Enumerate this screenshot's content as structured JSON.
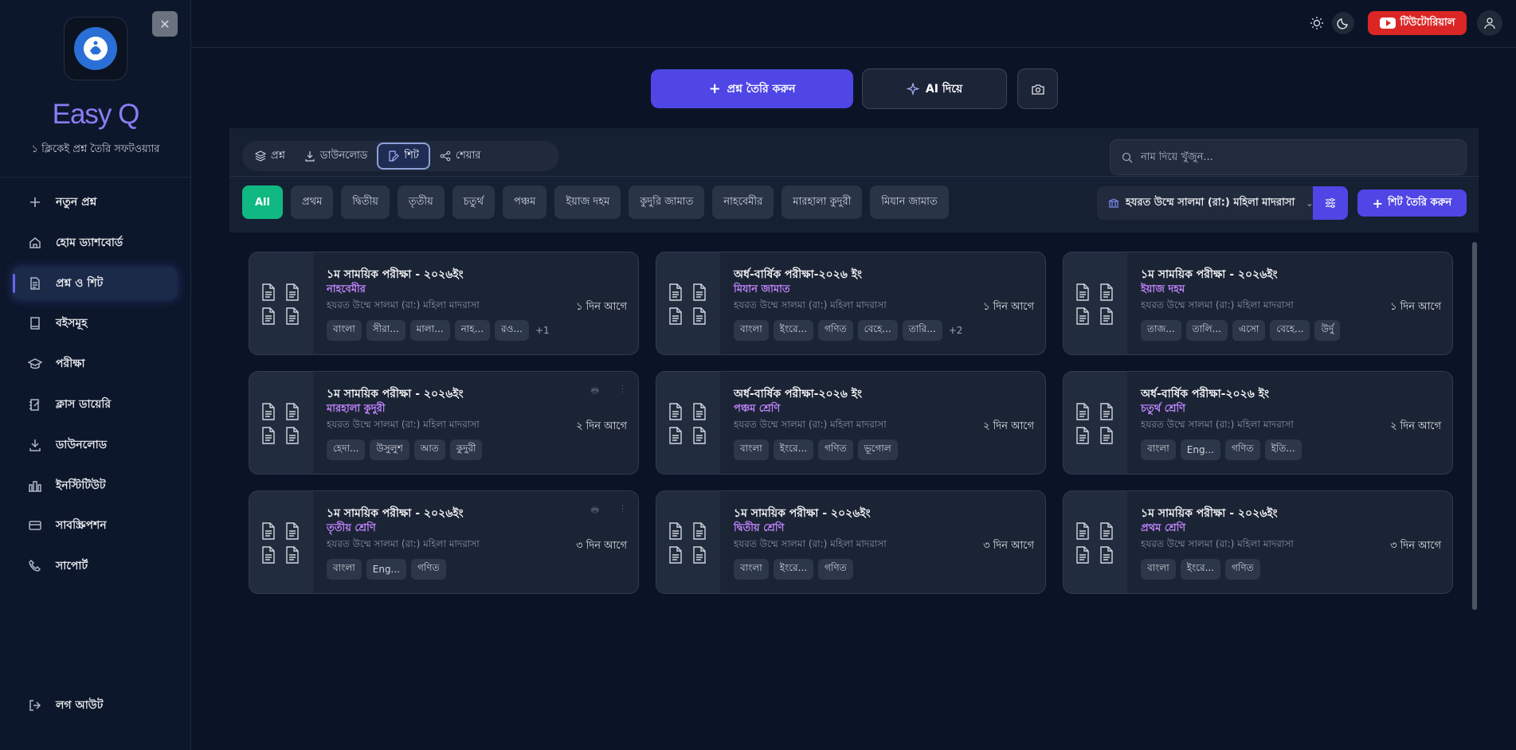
{
  "app": {
    "name": "Easy Q",
    "tagline": "১ ক্লিকেই প্রশ্ন তৈরি সফটওয়্যার"
  },
  "sidebar": {
    "items": [
      {
        "label": "নতুন প্রশ্ন",
        "icon": "plus-icon"
      },
      {
        "label": "হোম ড্যাশবোর্ড",
        "icon": "home-icon"
      },
      {
        "label": "প্রশ্ন ও শিট",
        "icon": "document-icon",
        "active": true
      },
      {
        "label": "বইসমূহ",
        "icon": "book-icon"
      },
      {
        "label": "পরীক্ষা",
        "icon": "graduation-cap-icon"
      },
      {
        "label": "ক্লাস ডায়েরি",
        "icon": "diary-icon"
      },
      {
        "label": "ডাউনলোড",
        "icon": "download-icon"
      },
      {
        "label": "ইনস্টিটিউট",
        "icon": "institute-icon"
      },
      {
        "label": "সাবস্ক্রিপশন",
        "icon": "credit-card-icon"
      },
      {
        "label": "সাপোর্ট",
        "icon": "phone-icon"
      }
    ],
    "logout": "লগ আউট"
  },
  "topbar": {
    "tutorial_label": "টিউটোরিয়াল"
  },
  "actions": {
    "create_label": "প্রশ্ন তৈরি করুন",
    "ai_label": "AI দিয়ে"
  },
  "tabs": [
    {
      "label": "প্রশ্ন",
      "icon": "layers-icon"
    },
    {
      "label": "ডাউনলোড",
      "icon": "download-icon"
    },
    {
      "label": "শিট",
      "icon": "edit-sheet-icon",
      "active": true
    },
    {
      "label": "শেয়ার",
      "icon": "share-icon"
    }
  ],
  "search": {
    "placeholder": "নাম দিয়ে খুঁজুন..."
  },
  "filters": [
    "All",
    "প্রথম",
    "দ্বিতীয়",
    "তৃতীয়",
    "চতুর্থ",
    "পঞ্চম",
    "ইয়াজ দহম",
    "কুদুরি জামাত",
    "নাহবেমীর",
    "মারহালা কুদুরী",
    "মিযান জামাত"
  ],
  "institute_select": "হযরত উম্মে সালমা (রা:) মহিলা মাদরাসা",
  "sheet_create_label": "শিট তৈরি করুন",
  "colors": {
    "accent": "#4f46e5",
    "active_filter": "#10b981",
    "class_text": "#c084fc",
    "tutorial": "#dc2626"
  },
  "cards": [
    {
      "title": "১ম সাময়িক পরীক্ষা - ২০২৬ইং",
      "class": "নাহবেমীর",
      "institute": "হযরত উম্মে সালমা (রা:) মহিলা মাদরাসা",
      "time": "১ দিন আগে",
      "tags": [
        "বাংলা",
        "সীরা...",
        "মালা...",
        "নাহ...",
        "রও..."
      ],
      "more": "+1"
    },
    {
      "title": "অর্ধ-বার্ষিক পরীক্ষা-২০২৬ ইং",
      "class": "মিযান জামাত",
      "institute": "হযরত উম্মে সালমা (রা:) মহিলা মাদরাসা",
      "time": "১ দিন আগে",
      "tags": [
        "বাংলা",
        "ইংরে...",
        "গণিত",
        "বেহে...",
        "তারি..."
      ],
      "more": "+2"
    },
    {
      "title": "১ম সাময়িক পরীক্ষা - ২০২৬ইং",
      "class": "ইয়াজ দহম",
      "institute": "হযরত উম্মে সালমা (রা:) মহিলা মাদরাসা",
      "time": "১ দিন আগে",
      "tags": [
        "তাজ...",
        "তালি...",
        "এসো",
        "বেহে...",
        "উর্দু"
      ],
      "more": ""
    },
    {
      "title": "১ম সাময়িক পরীক্ষা - ২০২৬ইং",
      "class": "মারহালা কুদুরী",
      "institute": "হযরত উম্মে সালমা (রা:) মহিলা মাদরাসা",
      "time": "২ দিন আগে",
      "tags": [
        "হেদা...",
        "উসুলুশ",
        "আত",
        "কুদুরী"
      ],
      "more": "",
      "actions": true
    },
    {
      "title": "অর্ধ-বার্ষিক পরীক্ষা-২০২৬ ইং",
      "class": "পঞ্চম শ্রেণি",
      "institute": "হযরত উম্মে সালমা (রা:) মহিলা মাদরাসা",
      "time": "২ দিন আগে",
      "tags": [
        "বাংলা",
        "ইংরে...",
        "গণিত",
        "ভূগোল"
      ],
      "more": ""
    },
    {
      "title": "অর্ধ-বার্ষিক পরীক্ষা-২০২৬ ইং",
      "class": "চতুর্থ শ্রেণি",
      "institute": "হযরত উম্মে সালমা (রা:) মহিলা মাদরাসা",
      "time": "২ দিন আগে",
      "tags": [
        "বাংলা",
        "Eng...",
        "গণিত",
        "ইতি..."
      ],
      "more": ""
    },
    {
      "title": "১ম সাময়িক পরীক্ষা - ২০২৬ইং",
      "class": "তৃতীয় শ্রেণি",
      "institute": "হযরত উম্মে সালমা (রা:) মহিলা মাদরাসা",
      "time": "৩ দিন আগে",
      "tags": [
        "বাংলা",
        "Eng...",
        "গণিত"
      ],
      "more": "",
      "actions": true
    },
    {
      "title": "১ম সাময়িক পরীক্ষা - ২০২৬ইং",
      "class": "দ্বিতীয় শ্রেণি",
      "institute": "হযরত উম্মে সালমা (রা:) মহিলা মাদরাসা",
      "time": "৩ দিন আগে",
      "tags": [
        "বাংলা",
        "ইংরে...",
        "গণিত"
      ],
      "more": ""
    },
    {
      "title": "১ম সাময়িক পরীক্ষা - ২০২৬ইং",
      "class": "প্রথম শ্রেণি",
      "institute": "হযরত উম্মে সালমা (রা:) মহিলা মাদরাসা",
      "time": "৩ দিন আগে",
      "tags": [
        "বাংলা",
        "ইংরে...",
        "গণিত"
      ],
      "more": ""
    }
  ]
}
